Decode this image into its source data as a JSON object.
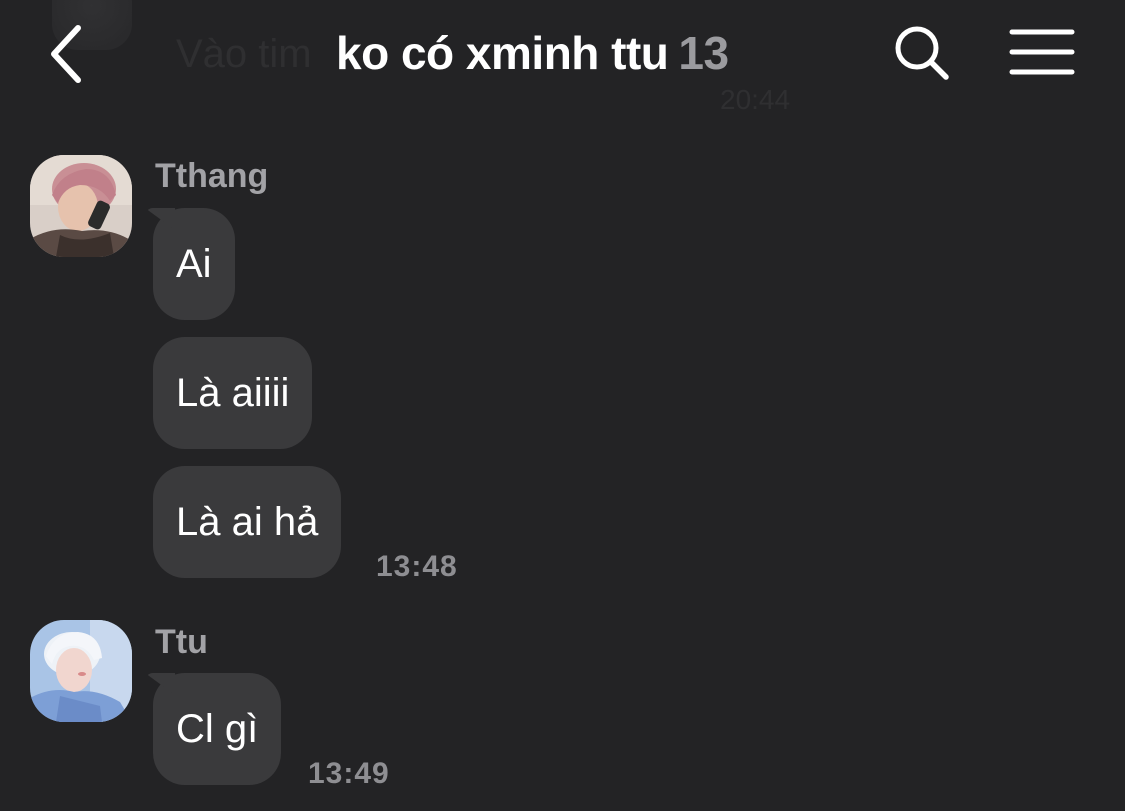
{
  "background": {
    "ghost_text": "Vào tim",
    "ghost_time": "20:44"
  },
  "header": {
    "title": "ko có xminh ttu",
    "member_count": "13",
    "back_icon": "chevron-left-icon",
    "search_icon": "search-icon",
    "menu_icon": "hamburger-menu-icon"
  },
  "messages": [
    {
      "sender": "Tthang",
      "bubbles": [
        "Ai",
        "Là aiiii",
        "Là ai hả"
      ],
      "time": "13:48"
    },
    {
      "sender": "Ttu",
      "bubbles": [
        "Cl gì"
      ],
      "time": "13:49"
    }
  ],
  "colors": {
    "background": "#232325",
    "bubble": "#3a3a3c",
    "text": "#ffffff",
    "secondary": "#9b9b9f"
  }
}
